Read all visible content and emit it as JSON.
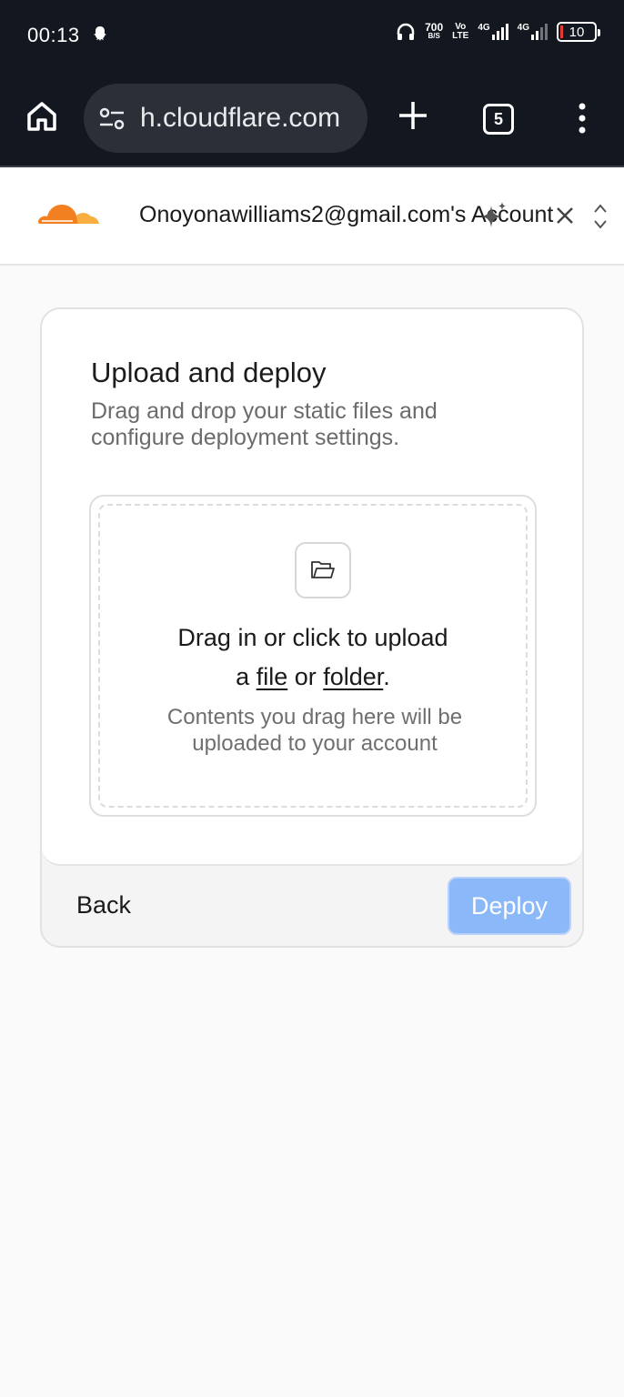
{
  "status_bar": {
    "time": "00:13",
    "net_speed_value": "700",
    "net_speed_unit": "B/S",
    "volte_top": "Vo",
    "volte_bottom": "LTE",
    "net1": "4G",
    "net2": "4G",
    "battery": "10"
  },
  "browser": {
    "url": "h.cloudflare.com",
    "tab_count": "5"
  },
  "account": {
    "name": "Onoyonawilliams2@gmail.com's Account"
  },
  "card": {
    "title": "Upload and deploy",
    "description": "Drag and drop your static files and configure deployment settings.",
    "dropzone": {
      "line1": "Drag in or click to upload",
      "prefix": "a ",
      "file_link": "file",
      "or": " or ",
      "folder_link": "folder",
      "suffix": ".",
      "note": "Contents you drag here will be uploaded to your account"
    },
    "back_label": "Back",
    "deploy_label": "Deploy"
  },
  "colors": {
    "status_bg": "#131820",
    "deploy_disabled": "#8bb8f8",
    "cloudflare_orange": "#f38020"
  }
}
